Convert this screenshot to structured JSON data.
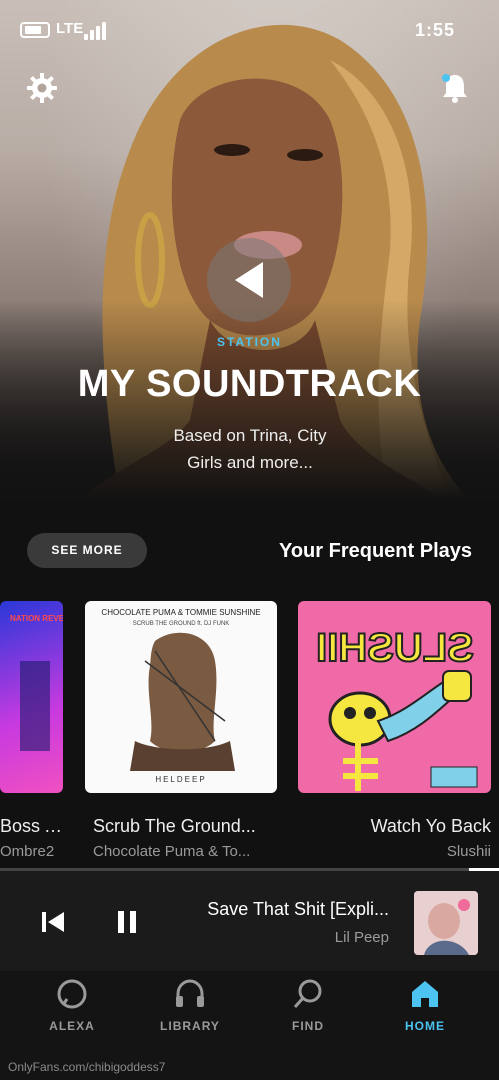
{
  "status_bar": {
    "time": "1:55",
    "network": "LTE"
  },
  "hero": {
    "label": "STATION",
    "title": "MY SOUNDTRACK",
    "subtitle_line1": "Based on Trina, City",
    "subtitle_line2": "Girls and more..."
  },
  "frequent": {
    "title": "Your Frequent Plays",
    "see_more": "SEE MORE",
    "items": [
      {
        "title": "Watch Yo Back",
        "subtitle": "Slushii",
        "art_text": "SLUSHII"
      },
      {
        "title": "Scrub The Ground...",
        "subtitle": "Chocolate Puma & To...",
        "art_top": "CHOCOLATE PUMA & TOMMIE SUNSHINE",
        "art_sub": "SCRUB THE GROUND ft. DJ FUNK",
        "art_bottom": "HELDEEP"
      },
      {
        "title": "Boss As",
        "subtitle": "Ombre2",
        "art_text": "NATION REVENGE TOUR MIXTAPE"
      }
    ]
  },
  "now_playing": {
    "title": "Save That Shit [Expli...",
    "artist": "Lil Peep",
    "progress": 0.06
  },
  "tabs": [
    {
      "label": "HOME",
      "icon": "home-icon",
      "active": true
    },
    {
      "label": "FIND",
      "icon": "search-icon",
      "active": false
    },
    {
      "label": "LIBRARY",
      "icon": "headphones-icon",
      "active": false
    },
    {
      "label": "ALEXA",
      "icon": "alexa-icon",
      "active": false
    }
  ],
  "watermark": "OnlyFans.com/chibigoddess7",
  "colors": {
    "accent": "#4cc3f0",
    "background": "#121212",
    "slushii_bg": "#f06aa8",
    "slushii_yellow": "#f5e640"
  }
}
